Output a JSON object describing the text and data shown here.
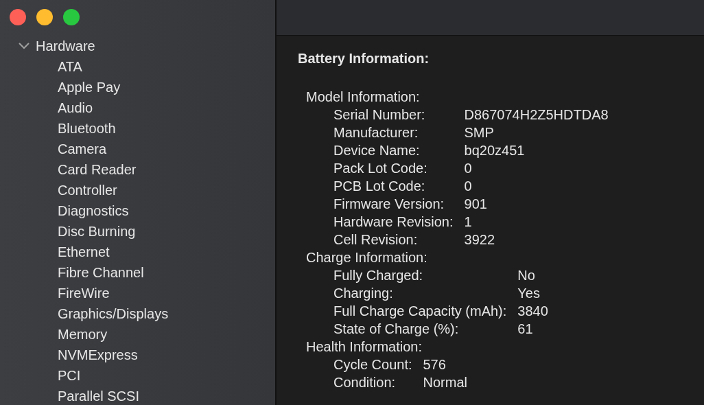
{
  "window": {
    "controls": [
      {
        "color": "#fe5f57"
      },
      {
        "color": "#febc2e"
      },
      {
        "color": "#28c840"
      }
    ]
  },
  "sidebar": {
    "items": [
      {
        "label": "Hardware",
        "expanded": true,
        "selected": false,
        "children": [
          {
            "label": "ATA",
            "selected": false
          },
          {
            "label": "Apple Pay",
            "selected": false
          },
          {
            "label": "Audio",
            "selected": false
          },
          {
            "label": "Bluetooth",
            "selected": false
          },
          {
            "label": "Camera",
            "selected": false
          },
          {
            "label": "Card Reader",
            "selected": false
          },
          {
            "label": "Controller",
            "selected": false
          },
          {
            "label": "Diagnostics",
            "selected": false
          },
          {
            "label": "Disc Burning",
            "selected": false
          },
          {
            "label": "Ethernet",
            "selected": false
          },
          {
            "label": "Fibre Channel",
            "selected": false
          },
          {
            "label": "FireWire",
            "selected": false
          },
          {
            "label": "Graphics/Displays",
            "selected": false
          },
          {
            "label": "Memory",
            "selected": false
          },
          {
            "label": "NVMExpress",
            "selected": false
          },
          {
            "label": "PCI",
            "selected": false
          },
          {
            "label": "Parallel SCSI",
            "selected": false
          }
        ]
      }
    ]
  },
  "details": {
    "title": "Battery Information:",
    "sections": [
      {
        "title": "Model Information:",
        "rows": [
          {
            "label": "Serial Number:",
            "value": "D867074H2Z5HDTDA8"
          },
          {
            "label": "Manufacturer:",
            "value": "SMP"
          },
          {
            "label": "Device Name:",
            "value": "bq20z451"
          },
          {
            "label": "Pack Lot Code:",
            "value": "0"
          },
          {
            "label": "PCB Lot Code:",
            "value": "0"
          },
          {
            "label": "Firmware Version:",
            "value": "901"
          },
          {
            "label": "Hardware Revision:",
            "value": "1"
          },
          {
            "label": "Cell Revision:",
            "value": "3922"
          }
        ]
      },
      {
        "title": "Charge Information:",
        "rows": [
          {
            "label": "Fully Charged:",
            "value": "No"
          },
          {
            "label": "Charging:",
            "value": "Yes"
          },
          {
            "label": "Full Charge Capacity (mAh):",
            "value": "3840"
          },
          {
            "label": "State of Charge (%):",
            "value": "61"
          }
        ]
      },
      {
        "title": "Health Information:",
        "rows": [
          {
            "label": "Cycle Count:",
            "value": "576"
          },
          {
            "label": "Condition:",
            "value": "Normal"
          }
        ]
      }
    ]
  }
}
